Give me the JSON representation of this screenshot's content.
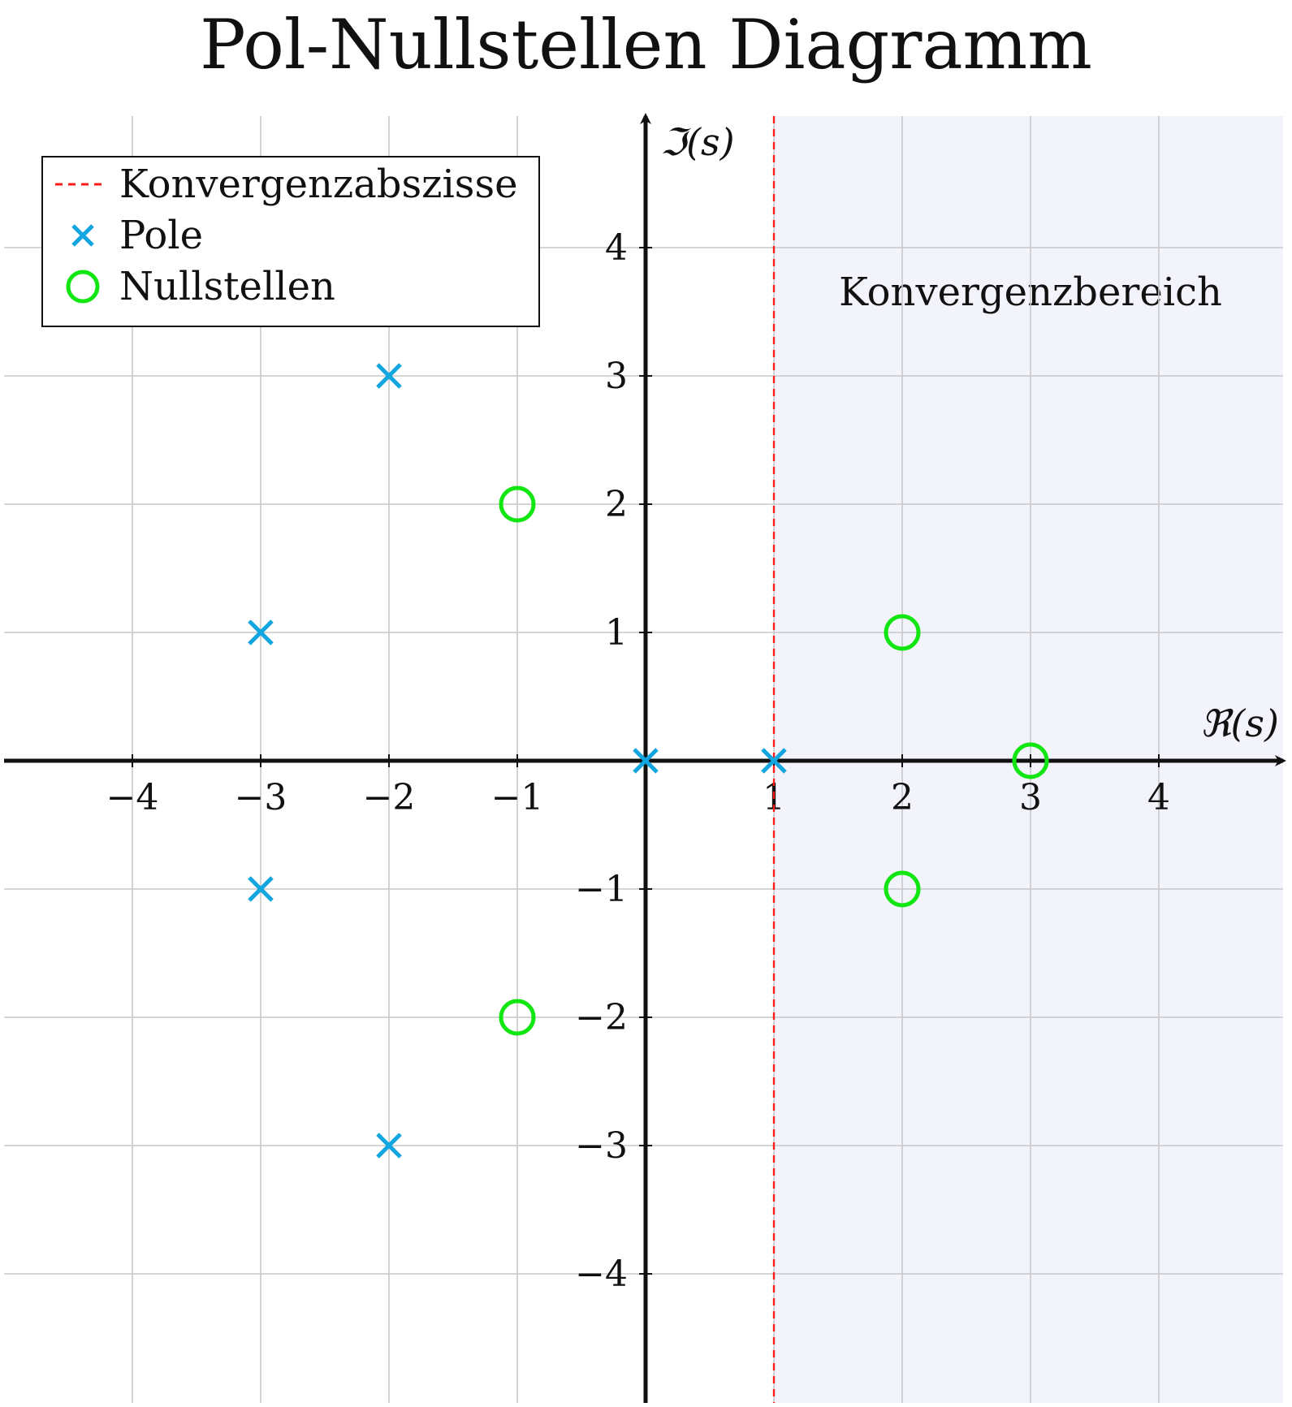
{
  "chart_data": {
    "type": "scatter",
    "title": "Pol-Nullstellen Diagramm",
    "xlabel": "ℜ(s)",
    "ylabel": "ℑ(s)",
    "xlim": [
      -5,
      5
    ],
    "ylim": [
      -5,
      5
    ],
    "x_ticks": [
      -4,
      -3,
      -2,
      -1,
      1,
      2,
      3,
      4
    ],
    "y_ticks": [
      -4,
      -3,
      -2,
      -1,
      1,
      2,
      3,
      4
    ],
    "x_tick_labels": [
      "−4",
      "−3",
      "−2",
      "−1",
      "1",
      "2",
      "3",
      "4"
    ],
    "y_tick_labels": [
      "−4",
      "−3",
      "−2",
      "−1",
      "1",
      "2",
      "3",
      "4"
    ],
    "grid": true,
    "legend_position": "top-left",
    "convergence_abscissa": 1,
    "region_label": "Konvergenzbereich",
    "series": [
      {
        "name": "Konvergenzabszisse",
        "kind": "vertical-line",
        "x": 1,
        "color": "#ff1a1a"
      },
      {
        "name": "Pole",
        "kind": "cross",
        "color": "#12a6e0",
        "points": [
          [
            -3,
            1
          ],
          [
            -3,
            -1
          ],
          [
            -2,
            3
          ],
          [
            -2,
            -3
          ],
          [
            0,
            0
          ],
          [
            1,
            0
          ]
        ]
      },
      {
        "name": "Nullstellen",
        "kind": "circle",
        "color": "#12e612",
        "points": [
          [
            -1,
            2
          ],
          [
            -1,
            -2
          ],
          [
            2,
            1
          ],
          [
            2,
            -1
          ],
          [
            3,
            0
          ]
        ]
      }
    ],
    "region_fill": "#f3f4fb"
  }
}
